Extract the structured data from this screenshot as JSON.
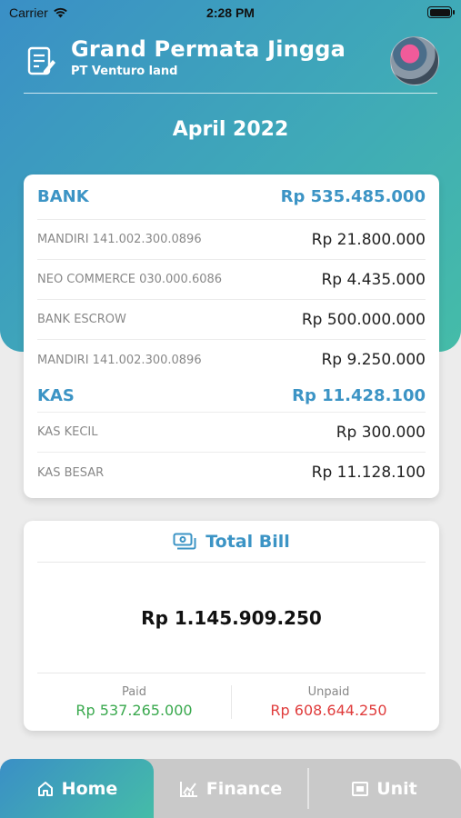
{
  "status_bar": {
    "carrier": "Carrier",
    "time": "2:28 PM"
  },
  "header": {
    "title": "Grand Permata Jingga",
    "subtitle": "PT Venturo land"
  },
  "period": "April 2022",
  "balances": {
    "bank": {
      "label": "BANK",
      "total": "Rp 535.485.000",
      "items": [
        {
          "label": "MANDIRI 141.002.300.0896",
          "value": "Rp 21.800.000"
        },
        {
          "label": "NEO COMMERCE 030.000.6086",
          "value": "Rp 4.435.000"
        },
        {
          "label": "BANK ESCROW",
          "value": "Rp 500.000.000"
        },
        {
          "label": "MANDIRI 141.002.300.0896",
          "value": "Rp 9.250.000"
        }
      ]
    },
    "kas": {
      "label": "KAS",
      "total": "Rp 11.428.100",
      "items": [
        {
          "label": "KAS KECIL",
          "value": "Rp 300.000"
        },
        {
          "label": "KAS BESAR",
          "value": "Rp 11.128.100"
        }
      ]
    }
  },
  "total_bill": {
    "title": "Total Bill",
    "amount": "Rp 1.145.909.250",
    "paid_label": "Paid",
    "paid_value": "Rp 537.265.000",
    "unpaid_label": "Unpaid",
    "unpaid_value": "Rp 608.644.250"
  },
  "tabs": [
    {
      "label": "Home",
      "icon": "home-icon",
      "active": true
    },
    {
      "label": "Finance",
      "icon": "chart-icon",
      "active": false
    },
    {
      "label": "Unit",
      "icon": "building-icon",
      "active": false
    }
  ],
  "colors": {
    "accent": "#3c94c5",
    "gradient_start": "#3a8fc6",
    "gradient_end": "#45bca8",
    "paid": "#3aa94e",
    "unpaid": "#e03d3d"
  }
}
